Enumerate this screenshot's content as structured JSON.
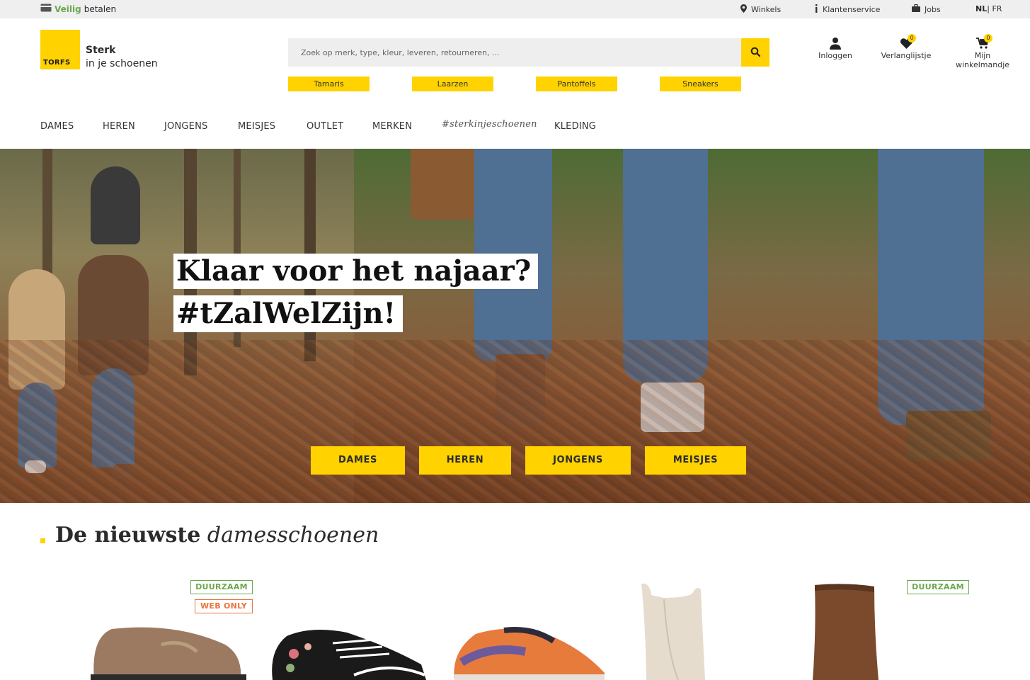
{
  "topbar": {
    "secure_word1": "Veilig",
    "secure_word2": "betalen",
    "links": [
      {
        "label": "Winkels",
        "icon": "map-pin-icon"
      },
      {
        "label": "Klantenservice",
        "icon": "info-icon"
      },
      {
        "label": "Jobs",
        "icon": "briefcase-icon"
      }
    ],
    "lang_nl": "NL",
    "lang_sep": "|",
    "lang_fr": "FR"
  },
  "header": {
    "logo_text": "TORFS",
    "tagline_line1": "Sterk",
    "tagline_line2": "in je schoenen",
    "search_placeholder": "Zoek op merk, type, kleur, leveren, retourneren, ...",
    "quick_links": [
      "Tamaris",
      "Laarzen",
      "Pantoffels",
      "Sneakers"
    ],
    "account_label": "Inloggen",
    "wishlist_label": "Verlanglijstje",
    "wishlist_count": "0",
    "cart_label": "Mijn winkelmandje",
    "cart_count": "0"
  },
  "nav": {
    "items": [
      "DAMES",
      "HEREN",
      "JONGENS",
      "MEISJES",
      "OUTLET",
      "MERKEN",
      "#sterkinjeschoenen",
      "KLEDING"
    ]
  },
  "hero": {
    "headline_line1": "Klaar voor het najaar?",
    "headline_line2": "#tZalWelZijn!",
    "buttons": [
      "DAMES",
      "HEREN",
      "JONGENS",
      "MEISJES"
    ]
  },
  "section": {
    "title_bold": "De nieuwste",
    "title_italic": "damesschoenen",
    "badges": {
      "duurzaam": "DUURZAAM",
      "web_only": "WEB ONLY"
    }
  },
  "colors": {
    "brand_yellow": "#ffd200",
    "badge_green": "#6aa84f",
    "badge_orange": "#e8743b"
  }
}
